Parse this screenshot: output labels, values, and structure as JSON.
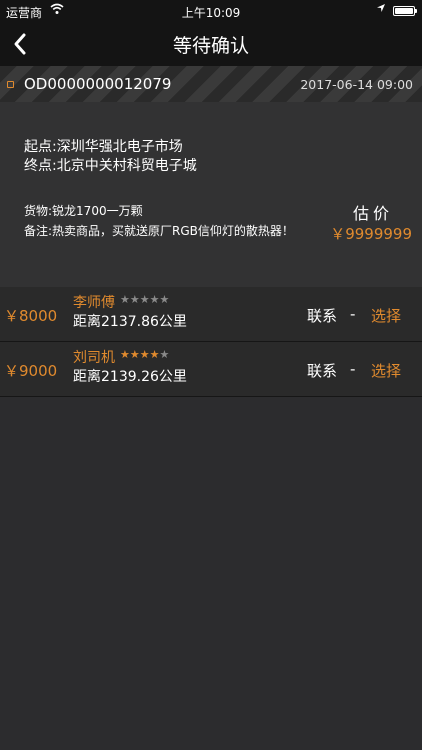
{
  "status_bar": {
    "carrier": "运营商",
    "time": "上午10:09"
  },
  "nav": {
    "title": "等待确认"
  },
  "order": {
    "id": "OD0000000012079",
    "datetime": "2017-06-14 09:00",
    "start": "起点:深圳华强北电子市场",
    "end": "终点:北京中关村科贸电子城",
    "cargo": "货物:锐龙1700一万颗",
    "note": "备注:热卖商品，买就送原厂RGB信仰灯的散热器！",
    "estimate_label": "估价",
    "estimate_price": "￥9999999"
  },
  "bids": [
    {
      "price": "￥8000",
      "driver": "李师傅",
      "rating": 0,
      "distance": "距离2137.86公里",
      "contact_label": "联系",
      "separator": "-",
      "select_label": "选择"
    },
    {
      "price": "￥9000",
      "driver": "刘司机",
      "rating": 4,
      "distance": "距离2139.26公里",
      "contact_label": "联系",
      "separator": "-",
      "select_label": "选择"
    }
  ],
  "colors": {
    "accent": "#e08a2e",
    "background": "#2c2c2e",
    "bar": "#141414"
  }
}
